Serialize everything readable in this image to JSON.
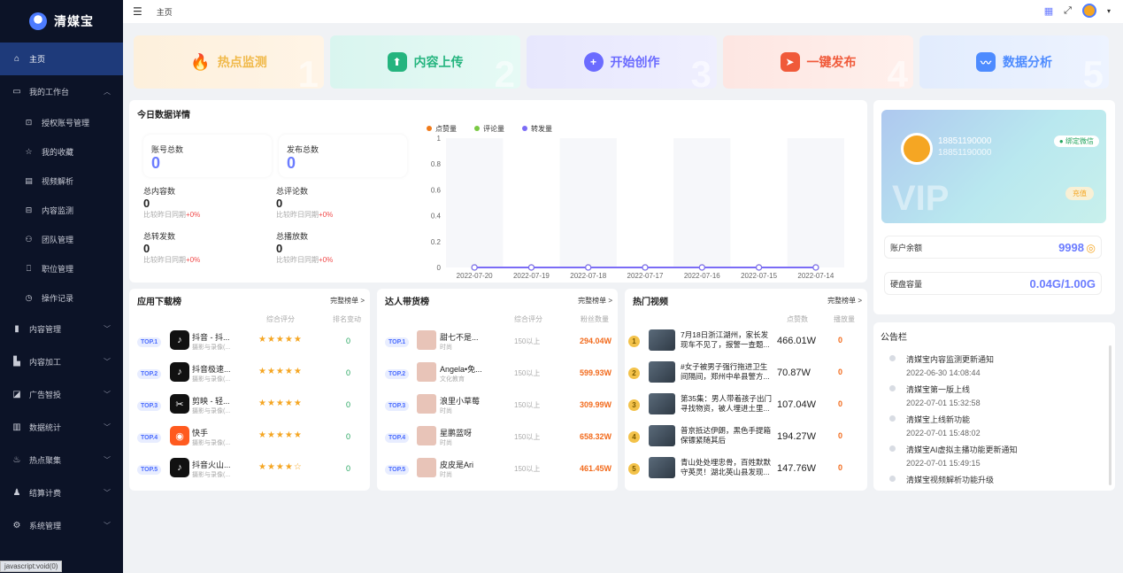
{
  "sidebar": {
    "logo": "清媒宝",
    "items": [
      {
        "label": "主页",
        "icon": "home-icon"
      },
      {
        "label": "我的工作台",
        "icon": "monitor-icon"
      },
      {
        "label": "内容管理",
        "icon": "file-icon"
      },
      {
        "label": "内容加工",
        "icon": "factory-icon"
      },
      {
        "label": "广告智投",
        "icon": "chart-icon"
      },
      {
        "label": "数据统计",
        "icon": "bar-icon"
      },
      {
        "label": "热点聚集",
        "icon": "fire-icon"
      },
      {
        "label": "结算计费",
        "icon": "bag-icon"
      },
      {
        "label": "系统管理",
        "icon": "gear-icon"
      }
    ],
    "subitems": [
      {
        "label": "授权账号管理"
      },
      {
        "label": "我的收藏"
      },
      {
        "label": "视频解析"
      },
      {
        "label": "内容监测"
      },
      {
        "label": "团队管理"
      },
      {
        "label": "职位管理"
      },
      {
        "label": "操作记录"
      }
    ],
    "status_link": "javascript:void(0)"
  },
  "topbar": {
    "breadcrumb": "主页"
  },
  "quick_actions": [
    {
      "label": "热点监测",
      "num": "1",
      "color": "#f0b94a"
    },
    {
      "label": "内容上传",
      "num": "2",
      "color": "#24b47e"
    },
    {
      "label": "开始创作",
      "num": "3",
      "color": "#6b6bff"
    },
    {
      "label": "一键发布",
      "num": "4",
      "color": "#f05a3a"
    },
    {
      "label": "数据分析",
      "num": "5",
      "color": "#4d8bff"
    }
  ],
  "today": {
    "title": "今日数据详情",
    "account_total_label": "账号总数",
    "account_total": "0",
    "publish_total_label": "发布总数",
    "publish_total": "0",
    "metrics": [
      {
        "label": "总内容数",
        "value": "0",
        "cmp": "比较昨日同期",
        "pct": "+0%"
      },
      {
        "label": "总评论数",
        "value": "0",
        "cmp": "比较昨日同期",
        "pct": "+0%"
      },
      {
        "label": "总转发数",
        "value": "0",
        "cmp": "比较昨日同期",
        "pct": "+0%"
      },
      {
        "label": "总播放数",
        "value": "0",
        "cmp": "比较昨日同期",
        "pct": "+0%"
      }
    ]
  },
  "chart_data": {
    "type": "line",
    "x": [
      "2022-07-20",
      "2022-07-19",
      "2022-07-18",
      "2022-07-17",
      "2022-07-16",
      "2022-07-15",
      "2022-07-14"
    ],
    "series": [
      {
        "name": "点赞量",
        "values": [
          0,
          0,
          0,
          0,
          0,
          0,
          0
        ],
        "color": "#f07a1a"
      },
      {
        "name": "评论量",
        "values": [
          0,
          0,
          0,
          0,
          0,
          0,
          0
        ],
        "color": "#7ac943"
      },
      {
        "name": "转发量",
        "values": [
          0,
          0,
          0,
          0,
          0,
          0,
          0
        ],
        "color": "#7b6cf6"
      }
    ],
    "yticks": [
      "0",
      "0.2",
      "0.4",
      "0.6",
      "0.8",
      "1"
    ],
    "ylim": [
      0,
      1
    ],
    "legend": "top-left"
  },
  "app_rank": {
    "title": "应用下载榜",
    "more": "完整榜单 >",
    "col_score": "综合评分",
    "col_change": "排名变动",
    "rows": [
      {
        "badge": "TOP.1",
        "name": "抖音 - 抖...",
        "sub": "摄影与录像(...",
        "stars": "★★★★★",
        "change": "0",
        "bg": "#111",
        "glyph": "♪"
      },
      {
        "badge": "TOP.2",
        "name": "抖音极速...",
        "sub": "摄影与录像(...",
        "stars": "★★★★★",
        "change": "0",
        "bg": "#111",
        "glyph": "♪"
      },
      {
        "badge": "TOP.3",
        "name": "剪映 - 轻...",
        "sub": "摄影与录像(...",
        "stars": "★★★★★",
        "change": "0",
        "bg": "#111",
        "glyph": "✂"
      },
      {
        "badge": "TOP.4",
        "name": "快手",
        "sub": "摄影与录像(...",
        "stars": "★★★★★",
        "change": "0",
        "bg": "#ff5a1f",
        "glyph": "◉"
      },
      {
        "badge": "TOP.5",
        "name": "抖音火山...",
        "sub": "摄影与录像(...",
        "stars": "★★★★☆",
        "change": "0",
        "bg": "#111",
        "glyph": "♪"
      }
    ]
  },
  "influencer_rank": {
    "title": "达人带货榜",
    "more": "完整榜单 >",
    "col_score": "综合评分",
    "col_fans": "粉丝数量",
    "rows": [
      {
        "badge": "TOP.1",
        "name": "甜七不是...",
        "sub": "时尚",
        "level": "150以上",
        "fans": "294.04W"
      },
      {
        "badge": "TOP.2",
        "name": "Angela•免...",
        "sub": "文化教育",
        "level": "150以上",
        "fans": "599.93W"
      },
      {
        "badge": "TOP.3",
        "name": "浪里小草莓",
        "sub": "时尚",
        "level": "150以上",
        "fans": "309.99W"
      },
      {
        "badge": "TOP.4",
        "name": "星鹏蓝呀",
        "sub": "时尚",
        "level": "150以上",
        "fans": "658.32W"
      },
      {
        "badge": "TOP.5",
        "name": "皮皮是Ari",
        "sub": "时尚",
        "level": "150以上",
        "fans": "461.45W"
      }
    ]
  },
  "hot_videos": {
    "title": "热门视频",
    "more": "完整榜单 >",
    "col_likes": "点赞数",
    "col_plays": "播放量",
    "rows": [
      {
        "rank": "1",
        "title": "7月18日浙江湖州，家长发现车不见了，报警一查题...",
        "likes": "466.01W",
        "plays": "0"
      },
      {
        "rank": "2",
        "title": "#女子被男子强行拖进卫生间隔间，郑州中牟县警方...",
        "likes": "70.87W",
        "plays": "0"
      },
      {
        "rank": "3",
        "title": "第35集：男人带着孩子出门寻找物资，被人埋进土里...",
        "likes": "107.04W",
        "plays": "0"
      },
      {
        "rank": "4",
        "title": "普京抵达伊朗，黑色手提箱保镖紧随其后",
        "likes": "194.27W",
        "plays": "0"
      },
      {
        "rank": "5",
        "title": "青山处处埋忠骨，百姓默默守英灵！湖北英山县发现...",
        "likes": "147.76W",
        "plays": "0"
      }
    ]
  },
  "user": {
    "phone": "18851190000",
    "phone2": "18851190000",
    "wx": "绑定微信",
    "vip": "VIP",
    "recharge": "充值",
    "balance_label": "账户余额",
    "balance": "9998",
    "storage_label": "硬盘容量",
    "storage": "0.04G/1.00G"
  },
  "notices": {
    "title": "公告栏",
    "items": [
      {
        "text": "清媒宝内容监测更新通知",
        "time": "2022-06-30 14:08:44"
      },
      {
        "text": "清媒宝第一版上线",
        "time": "2022-07-01 15:32:58"
      },
      {
        "text": "清媒宝上线新功能",
        "time": "2022-07-01 15:48:02"
      },
      {
        "text": "清媒宝AI虚拟主播功能更新通知",
        "time": "2022-07-01 15:49:15"
      },
      {
        "text": "清媒宝视频解析功能升级",
        "time": ""
      }
    ]
  }
}
